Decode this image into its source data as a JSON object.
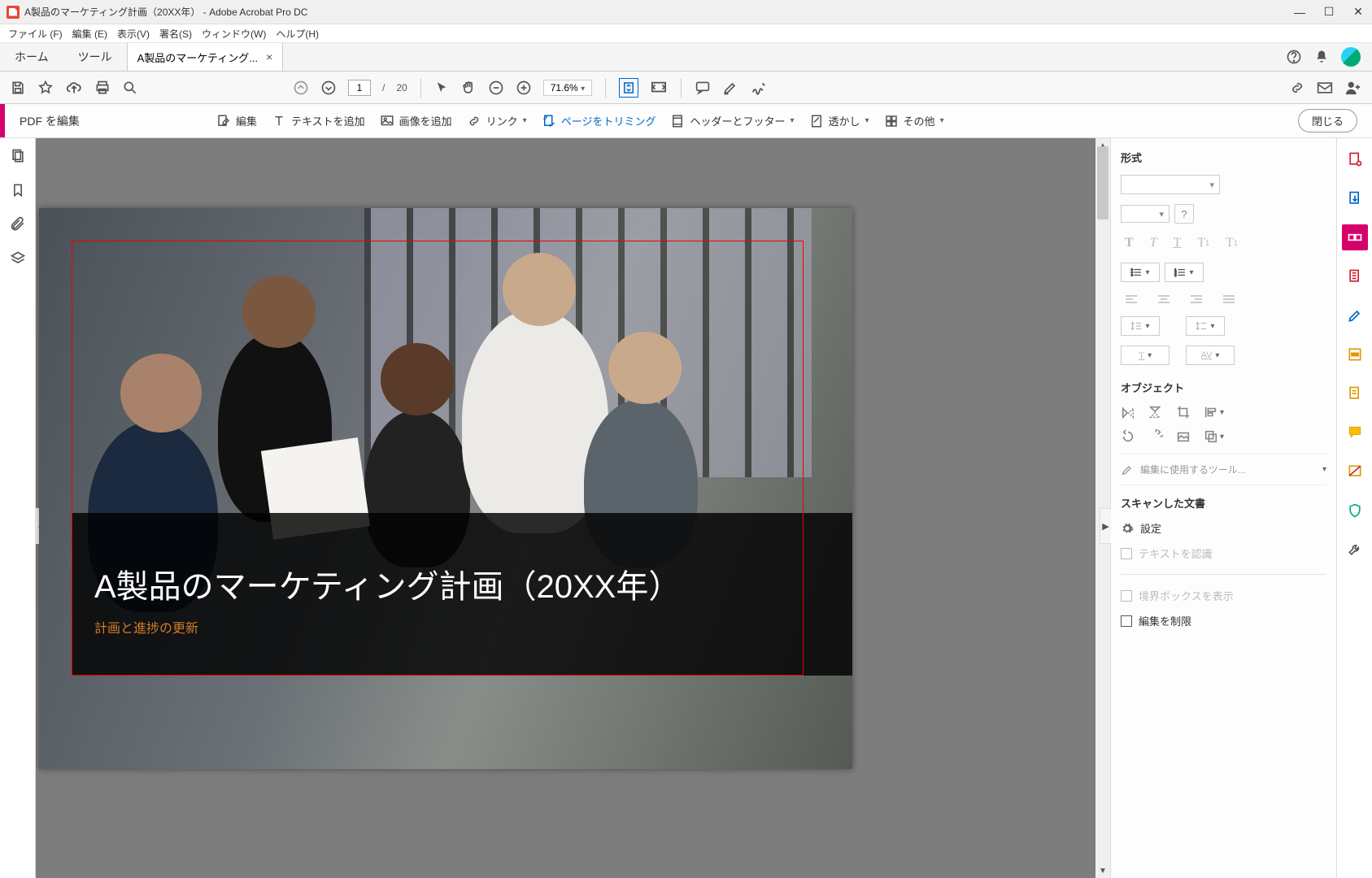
{
  "window": {
    "title": "A製品のマーケティング計画（20XX年） - Adobe Acrobat Pro DC",
    "min": "—",
    "max": "☐",
    "close": "✕"
  },
  "menu": {
    "file": "ファイル (F)",
    "edit": "編集 (E)",
    "view": "表示(V)",
    "sign": "署名(S)",
    "window": "ウィンドウ(W)",
    "help": "ヘルプ(H)"
  },
  "tabs": {
    "home": "ホーム",
    "tools": "ツール",
    "doc": "A製品のマーケティング..."
  },
  "toolbar": {
    "page_current": "1",
    "page_sep": "/",
    "page_total": "20",
    "zoom": "71.6%"
  },
  "edit": {
    "title": "PDF を編集",
    "edit": "編集",
    "addtext": "テキストを追加",
    "addimage": "画像を追加",
    "link": "リンク",
    "trim": "ページをトリミング",
    "headerfooter": "ヘッダーとフッター",
    "watermark": "透かし",
    "other": "その他",
    "close": "閉じる"
  },
  "document": {
    "title": "A製品のマーケティング計画（20XX年）",
    "subtitle": "計画と進捗の更新"
  },
  "panel": {
    "format": "形式",
    "object": "オブジェクト",
    "edit_tools": "編集に使用するツール...",
    "scanned": "スキャンした文書",
    "settings": "設定",
    "recognize": "テキストを認識",
    "showbbox": "境界ボックスを表示",
    "restrict": "編集を制限",
    "av_label": "AV"
  },
  "rail": {
    "icons": [
      "create-pdf",
      "export-pdf",
      "edit-pdf",
      "organize",
      "sign",
      "redact",
      "protect",
      "comment",
      "compare",
      "shield",
      "customize"
    ]
  }
}
